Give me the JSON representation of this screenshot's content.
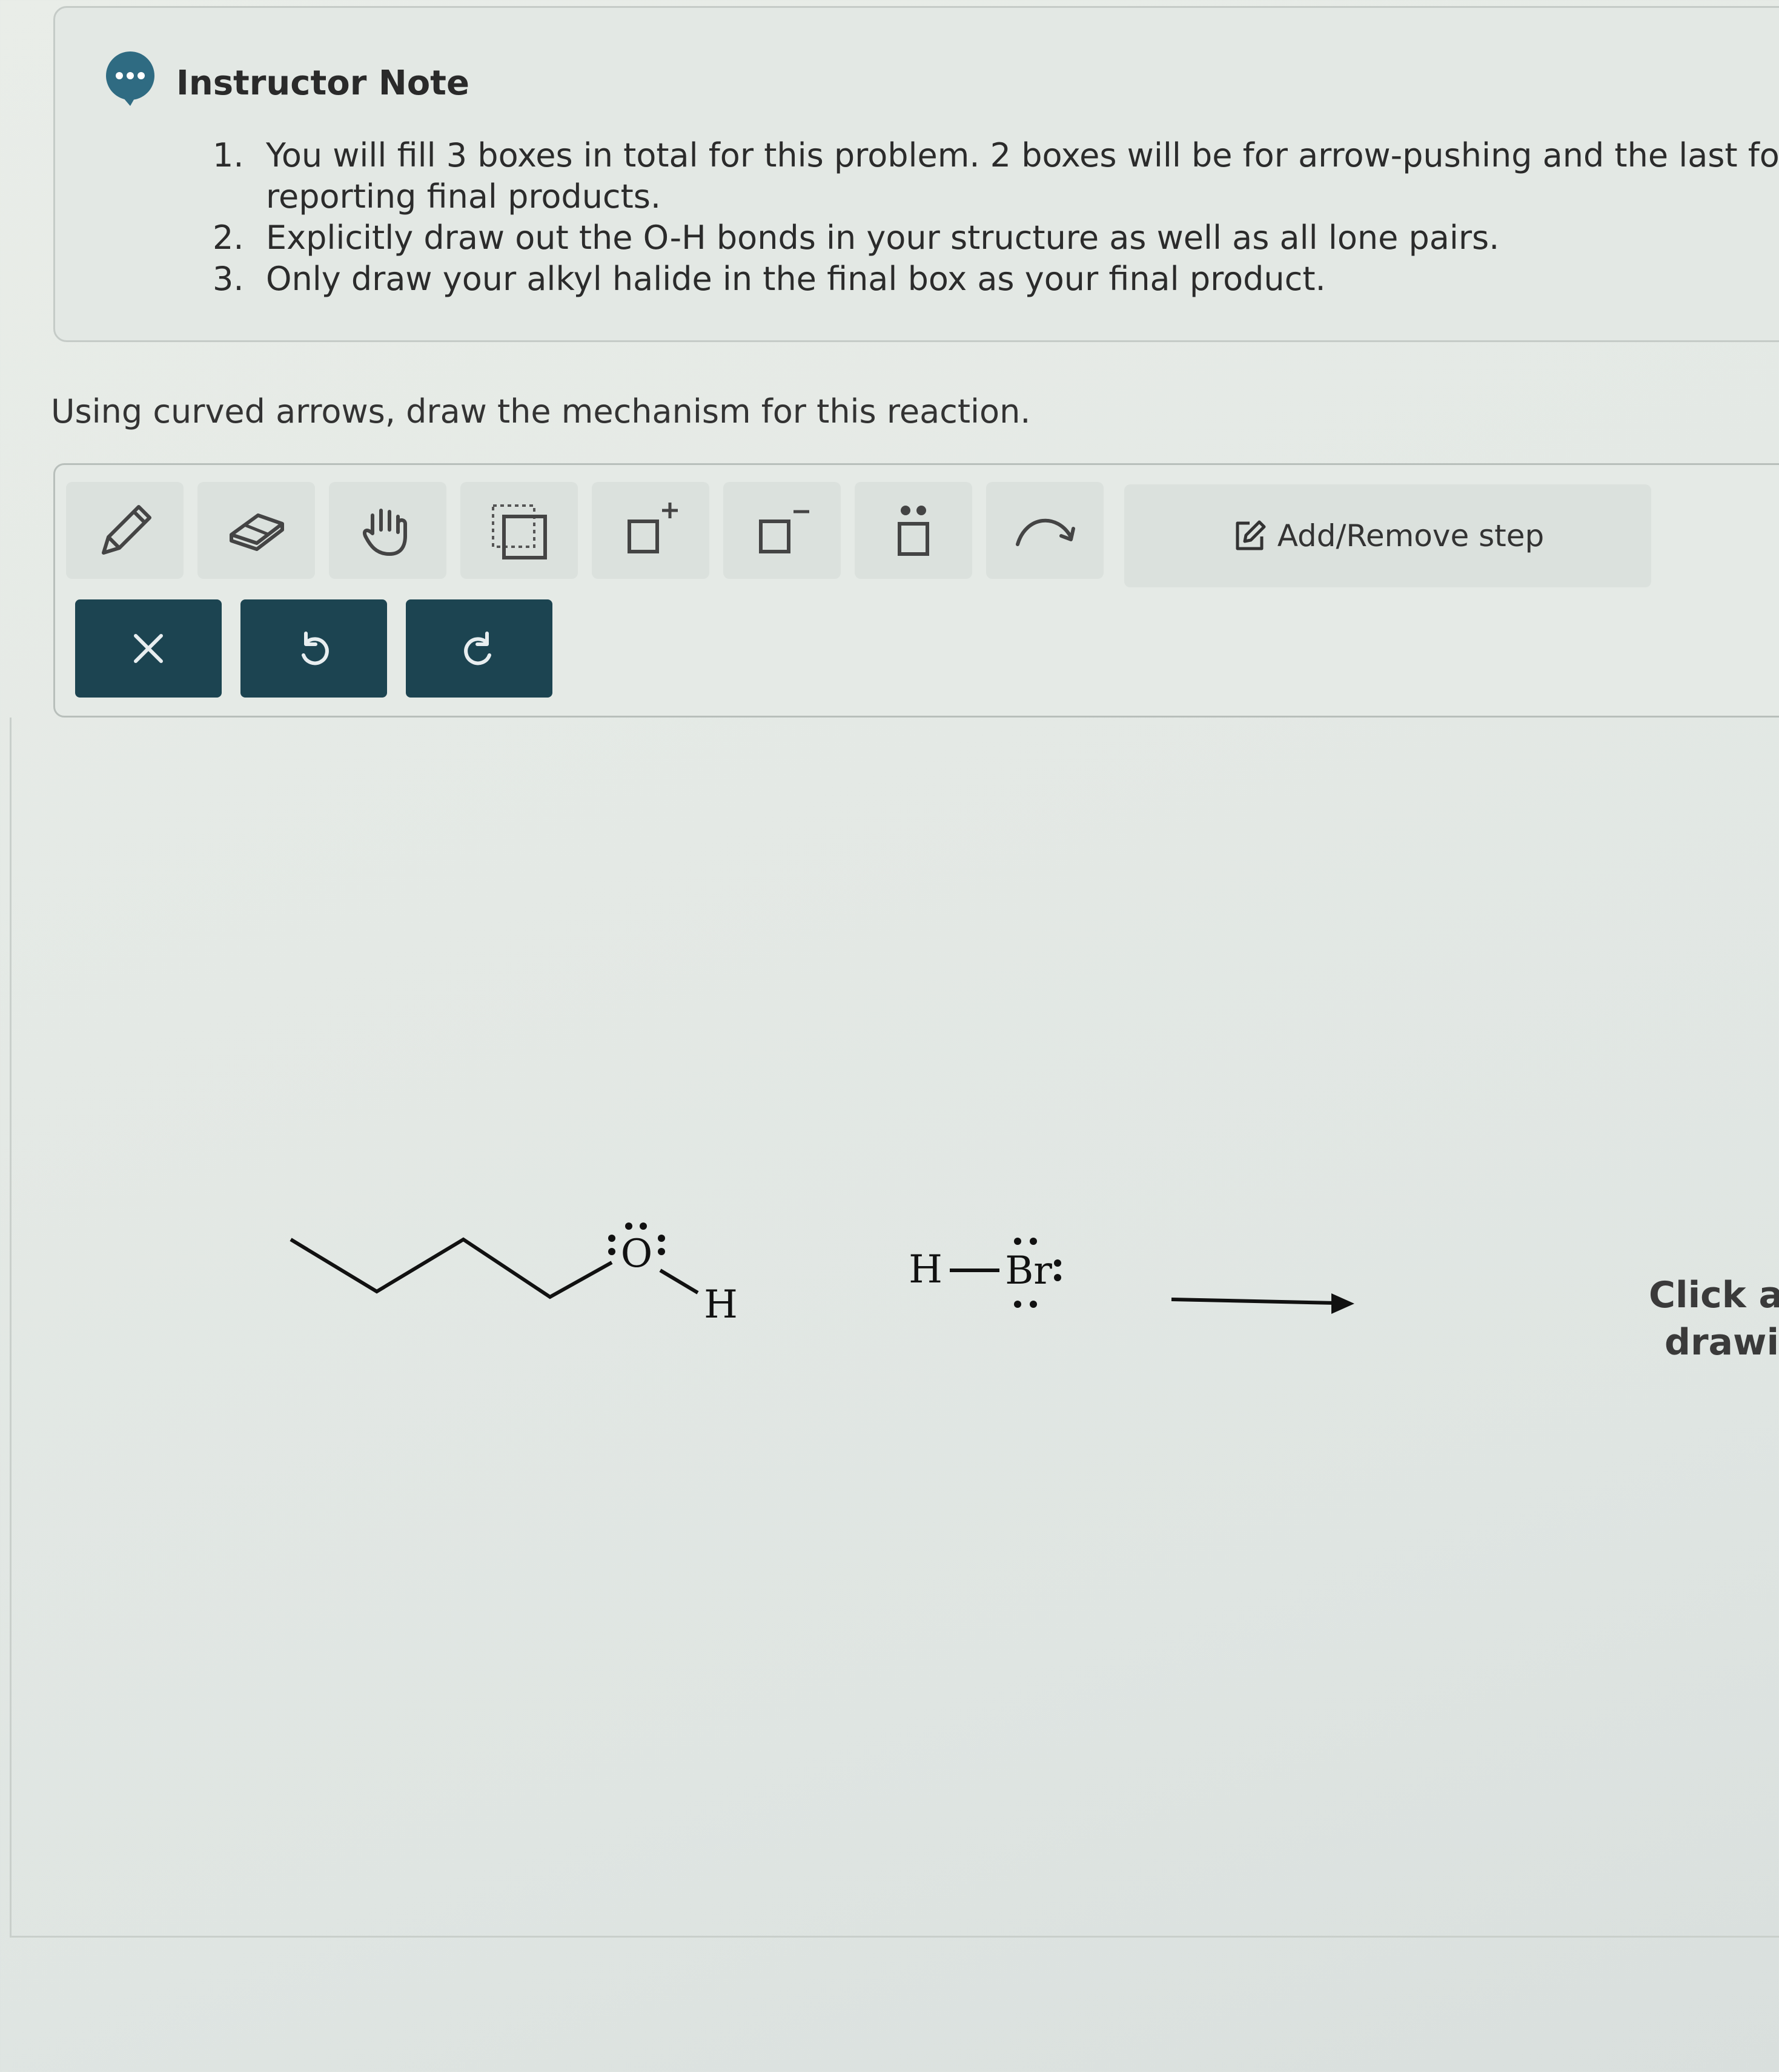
{
  "note": {
    "title": "Instructor Note",
    "items": [
      {
        "num": "1.",
        "text": "You will fill 3 boxes in total for this problem. 2 boxes will be for arrow-pushing and the last fo",
        "text2": "reporting final products."
      },
      {
        "num": "2.",
        "text": "Explicitly draw out the O-H bonds in your structure as well as all lone pairs."
      },
      {
        "num": "3.",
        "text": "Only draw your alkyl halide in the final box as your final product."
      }
    ]
  },
  "prompt": "Using curved arrows, draw the mechanism for this reaction.",
  "toolbar": {
    "tools": [
      "pencil-icon",
      "eraser-icon",
      "hand-icon",
      "select-icon",
      "positive-charge-icon",
      "negative-charge-icon",
      "lone-pair-icon",
      "curved-arrow-icon"
    ],
    "add_remove_step": "Add/Remove step",
    "actions": [
      "close-icon",
      "undo-icon",
      "redo-icon"
    ],
    "accent": "#1c4451"
  },
  "molecules": {
    "alcohol_oxygen": "O",
    "alcohol_hydrogen": "H",
    "hbr_h": "H",
    "hbr_br": "Br"
  },
  "click_hint": {
    "line1": "Click a",
    "line2": "drawi"
  }
}
